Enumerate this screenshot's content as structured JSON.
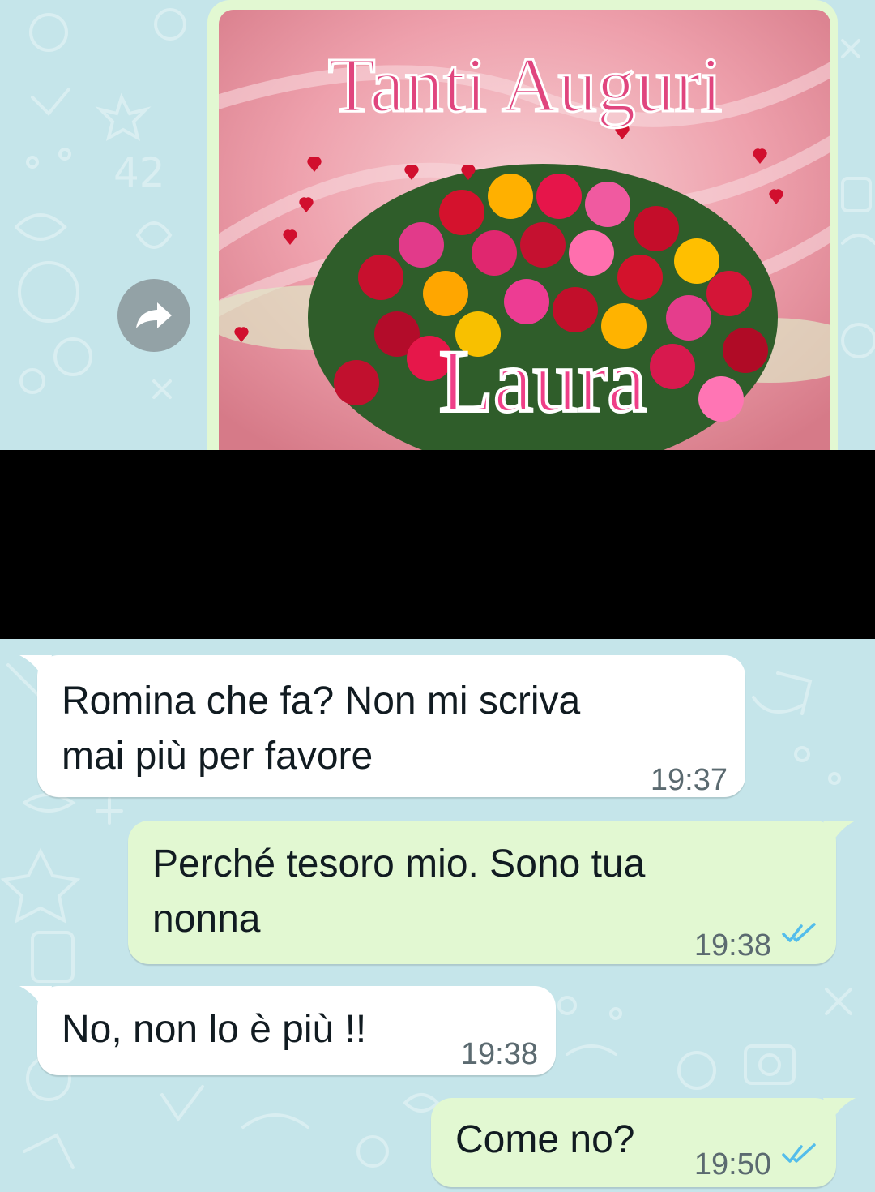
{
  "chat": {
    "image_message": {
      "image_title": "Tanti Auguri",
      "image_name": "Laura",
      "forward_icon": "forward-arrow-icon"
    },
    "messages": [
      {
        "direction": "incoming",
        "text": "Romina che fa? Non mi scriva\nmai più per favore",
        "time": "19:37"
      },
      {
        "direction": "outgoing",
        "text": "Perché tesoro mio. Sono tua\nnonna",
        "time": "19:38",
        "status_icon": "double-check-icon"
      },
      {
        "direction": "incoming",
        "text": "No, non lo è più !!",
        "time": "19:38"
      },
      {
        "direction": "outgoing",
        "text": "Come no?",
        "time": "19:50",
        "status_icon": "double-check-icon"
      }
    ]
  },
  "colors": {
    "wallpaper": "#c5e5ea",
    "incoming_bubble": "#ffffff",
    "outgoing_bubble": "#e2f8d2",
    "read_ticks": "#53bdeb",
    "redaction": "#000000"
  }
}
